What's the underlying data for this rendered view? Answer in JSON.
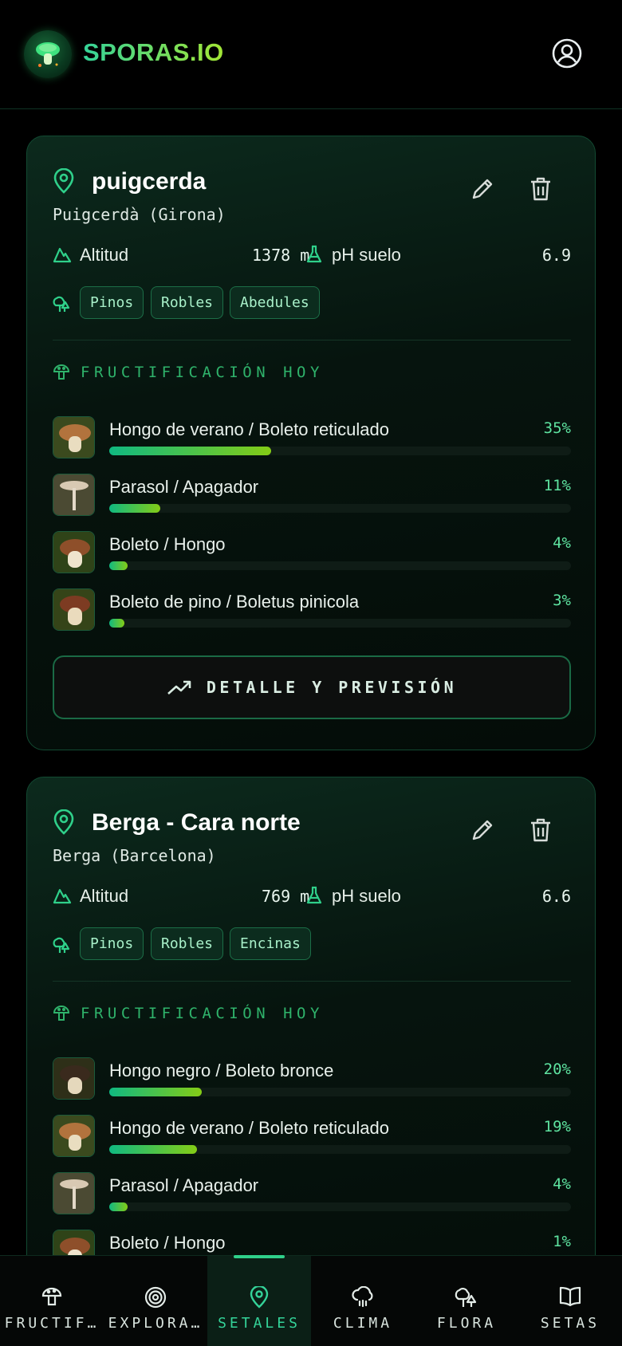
{
  "app": {
    "name": "SPORAS.IO"
  },
  "header": {
    "profile_icon": "user-circle-icon"
  },
  "colors": {
    "accent": "#34d399",
    "brand_gradient": [
      "#34d399",
      "#a3e635"
    ],
    "bar_gradient": [
      "#10b981",
      "#84cc16"
    ]
  },
  "spots": [
    {
      "name": "puigcerda",
      "location": "Puigcerdà (Girona)",
      "altitude_label": "Altitud",
      "altitude": "1378 m",
      "ph_label": "pH suelo",
      "ph": "6.9",
      "trees": [
        "Pinos",
        "Robles",
        "Abedules"
      ],
      "section_title": "FRUCTIFICACIÓN HOY",
      "species": [
        {
          "name": "Hongo de verano / Boleto reticulado",
          "percent_label": "35%",
          "percent": 35
        },
        {
          "name": "Parasol / Apagador",
          "percent_label": "11%",
          "percent": 11
        },
        {
          "name": "Boleto / Hongo",
          "percent_label": "4%",
          "percent": 4
        },
        {
          "name": "Boleto de pino / Boletus pinicola",
          "percent_label": "3%",
          "percent": 3
        }
      ],
      "detail_button": "DETALLE Y PREVISIÓN"
    },
    {
      "name": "Berga - Cara norte",
      "location": "Berga (Barcelona)",
      "altitude_label": "Altitud",
      "altitude": "769 m",
      "ph_label": "pH suelo",
      "ph": "6.6",
      "trees": [
        "Pinos",
        "Robles",
        "Encinas"
      ],
      "section_title": "FRUCTIFICACIÓN HOY",
      "species": [
        {
          "name": "Hongo negro / Boleto bronce",
          "percent_label": "20%",
          "percent": 20
        },
        {
          "name": "Hongo de verano / Boleto reticulado",
          "percent_label": "19%",
          "percent": 19
        },
        {
          "name": "Parasol / Apagador",
          "percent_label": "4%",
          "percent": 4
        },
        {
          "name": "Boleto / Hongo",
          "percent_label": "1%",
          "percent": 1
        }
      ]
    }
  ],
  "nav": [
    {
      "label": "FRUCTIF…",
      "icon": "mushroom-icon",
      "active": false
    },
    {
      "label": "EXPLORA…",
      "icon": "target-icon",
      "active": false
    },
    {
      "label": "SETALES",
      "icon": "map-pin-icon",
      "active": true
    },
    {
      "label": "CLIMA",
      "icon": "cloud-rain-icon",
      "active": false
    },
    {
      "label": "FLORA",
      "icon": "trees-icon",
      "active": false
    },
    {
      "label": "SETAS",
      "icon": "book-open-icon",
      "active": false
    }
  ]
}
